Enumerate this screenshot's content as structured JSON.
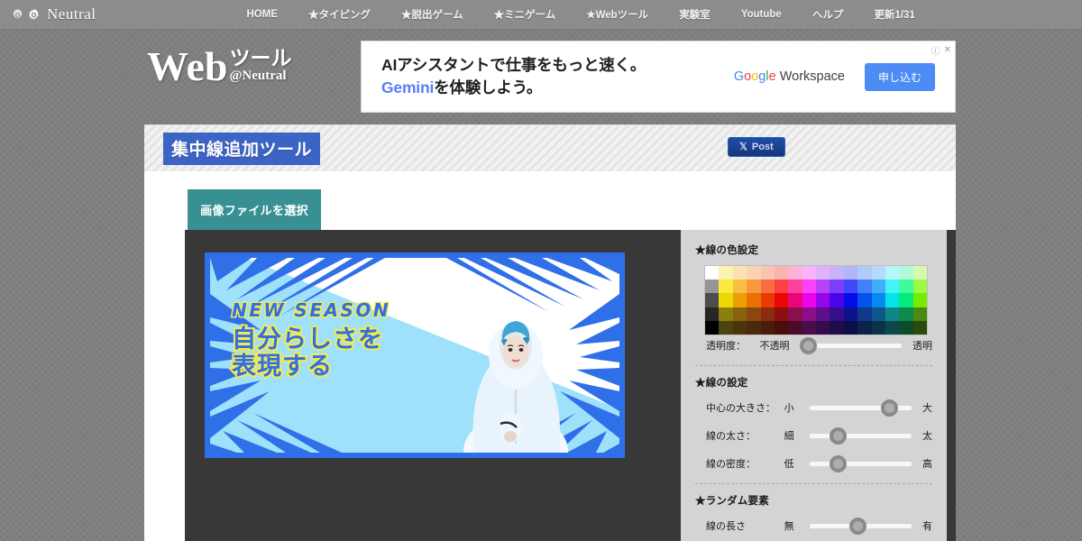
{
  "navbar": {
    "brand": "Neutral",
    "links": [
      {
        "label": "HOME"
      },
      {
        "label": "★タイピング"
      },
      {
        "label": "★脱出ゲーム"
      },
      {
        "label": "★ミニゲーム"
      },
      {
        "label": "★Webツール"
      },
      {
        "label": "実験室"
      },
      {
        "label": "Youtube"
      },
      {
        "label": "ヘルプ"
      },
      {
        "label": "更新1/31"
      }
    ]
  },
  "logo": {
    "main": "Web",
    "tool": "ツール",
    "sub": "@Neutral"
  },
  "ad": {
    "line1": "AIアシスタントで仕事をもっと速く。",
    "gemini": "Gemini",
    "line2": "を体験しよう。",
    "brand": "Google Workspace",
    "cta": "申し込む",
    "info_icon": "info-icon",
    "close_icon": "close-icon"
  },
  "titlebar": {
    "title": "集中線追加ツール",
    "post_label": "Post",
    "post_icon": "x-logo-icon"
  },
  "main": {
    "file_button": "画像ファイルを選択"
  },
  "preview": {
    "headline": "NEW SEASON",
    "sub_line1": "自分らしさを",
    "sub_line2": "表現する"
  },
  "panel": {
    "color_section": {
      "heading": "★線の色設定",
      "opacity_label": "透明度：",
      "opacity_low": "不透明",
      "opacity_high": "透明",
      "opacity_value": 0
    },
    "line_section": {
      "heading": "★線の設定",
      "rows": [
        {
          "label": "中心の大きさ：",
          "low": "小",
          "high": "大",
          "value": 78
        },
        {
          "label": "線の太さ：",
          "low": "細",
          "high": "太",
          "value": 22
        },
        {
          "label": "線の密度：",
          "low": "低",
          "high": "高",
          "value": 22
        }
      ]
    },
    "random_section": {
      "heading": "★ランダム要素",
      "rows": [
        {
          "label": "線の長さ",
          "low": "無",
          "high": "有",
          "value": 42
        }
      ]
    }
  },
  "colors": {
    "accent_blue": "#3b64c4",
    "teal": "#389092",
    "panel_gray": "#d4d4d4",
    "editor_dark": "#383838",
    "nav_gray": "#8c8c8c"
  }
}
